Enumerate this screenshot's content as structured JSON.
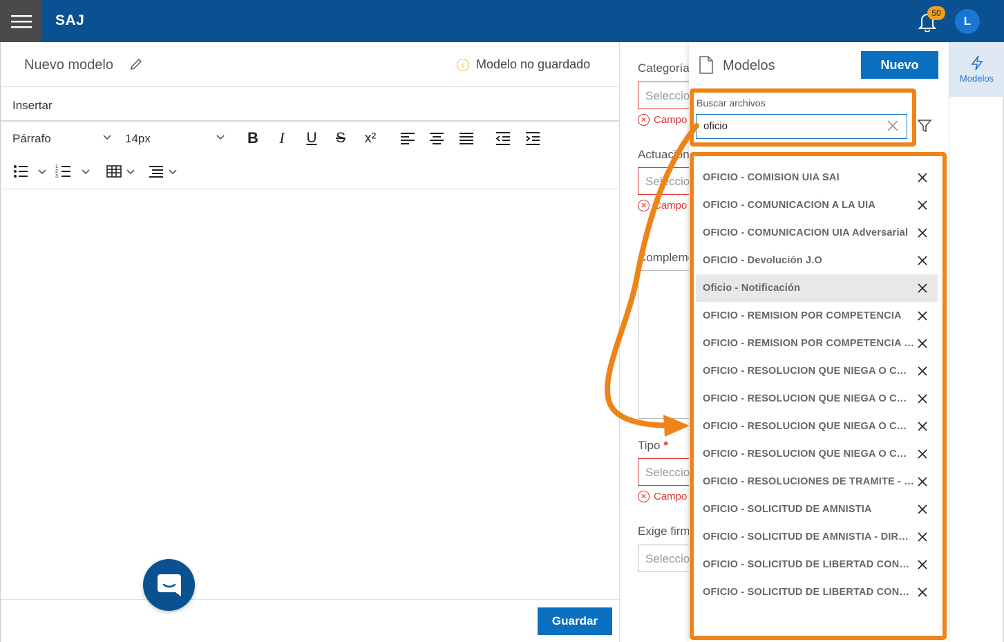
{
  "app": {
    "brand": "SAJ",
    "notification_count": "50",
    "user_initial": "L"
  },
  "editor": {
    "title": "Nuevo modelo",
    "status": "Modelo no guardado",
    "insert_menu": "Insertar",
    "paragraph_style": "Párrafo",
    "font_size": "14px",
    "save_label": "Guardar"
  },
  "form": {
    "categoria_label": "Categoría",
    "actuacion_label": "Actuación",
    "complemento_label": "Complemento",
    "tipo_label": "Tipo",
    "exige_label": "Exige firma",
    "select_placeholder": "Seleccione",
    "error_text": "Campo obligatorio"
  },
  "panel": {
    "title": "Modelos",
    "new_label": "Nuevo",
    "search_label": "Buscar archivos",
    "search_value": "oficio",
    "items": [
      "OFICIO - COMISION UIA SAI",
      "OFICIO - COMUNICACIÓN A LA UIA",
      "OFICIO - COMUNICACION UIA Adversarial",
      "OFICIO - Devolución J.O",
      "Oficio - Notificación",
      "OFICIO - REMISION POR COMPETENCIA",
      "OFICIO - REMISION POR COMPETENCIA - ...",
      "OFICIO - RESOLUCION QUE NIEGA O CON...",
      "OFICIO - RESOLUCION QUE NIEGA O CON...",
      "OFICIO - RESOLUCION QUE NIEGA O CON...",
      "OFICIO - RESOLUCION QUE NIEGA O CON...",
      "OFICIO - RESOLUCIONES DE TRAMITE - DI...",
      "OFICIO - SOLICITUD DE AMNISTIA",
      "OFICIO - SOLICITUD DE AMNISTIA - DIREC...",
      "OFICIO - SOLICITUD DE LIBERTAD CONDIC...",
      "OFICIO - SOLICITUD DE LIBERTAD CONDIC..."
    ],
    "highlighted_index": 4
  },
  "rail": {
    "tab_label": "Modelos"
  },
  "colors": {
    "header": "#0a5192",
    "accent": "#0a6fbf",
    "annotation": "#ee8418",
    "error": "#d33"
  }
}
